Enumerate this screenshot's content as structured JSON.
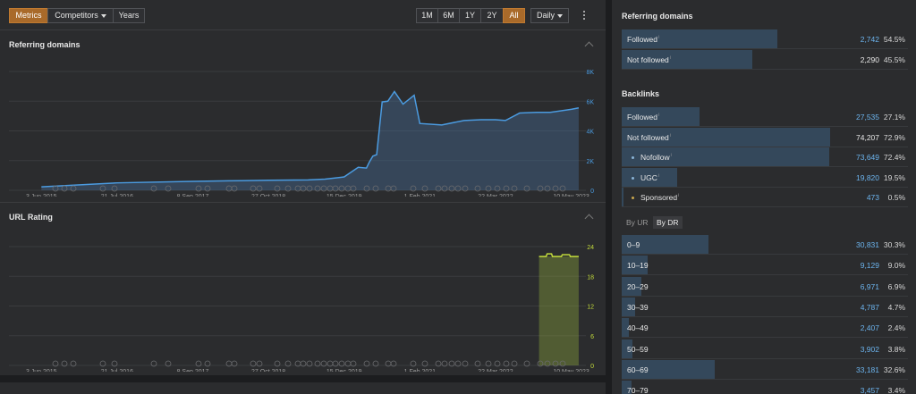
{
  "toolbar": {
    "metrics": "Metrics",
    "competitors": "Competitors",
    "years": "Years",
    "ranges": [
      "1M",
      "6M",
      "1Y",
      "2Y",
      "All"
    ],
    "active_range": "All",
    "granularity": "Daily"
  },
  "panels": {
    "referring_domains_title": "Referring domains",
    "url_rating_title": "URL Rating"
  },
  "x_ticks": [
    "3 Jun 2015",
    "21 Jul 2016",
    "8 Sep 2017",
    "27 Oct 2018",
    "15 Dec 2019",
    "1 Feb 2021",
    "22 Mar 2022",
    "10 May 2023"
  ],
  "colors": {
    "accent": "#a96a2a",
    "line_blue": "#4b9be0",
    "ur_green": "#c4dc3c",
    "bar_blue": "#34485b",
    "link_blue": "#6cb4ee"
  },
  "chart_data": [
    {
      "type": "area",
      "title": "Referring domains",
      "x": [
        "2015-06-03",
        "2016-07-21",
        "2017-09-08",
        "2018-06-01",
        "2018-10-27",
        "2019-06-01",
        "2019-09-01",
        "2019-12-15",
        "2020-03-01",
        "2020-04-15",
        "2020-05-01",
        "2020-05-20",
        "2020-06-10",
        "2020-07-10",
        "2020-08-10",
        "2020-09-15",
        "2020-11-01",
        "2021-01-01",
        "2021-02-01",
        "2021-06-01",
        "2021-10-01",
        "2022-01-01",
        "2022-03-22",
        "2022-05-15",
        "2022-08-01",
        "2022-11-01",
        "2023-01-15",
        "2023-05-10",
        "2023-06-20"
      ],
      "values": [
        230,
        500,
        600,
        650,
        680,
        700,
        750,
        900,
        1550,
        1500,
        1900,
        2300,
        2400,
        5950,
        6000,
        6650,
        5800,
        6400,
        4500,
        4400,
        4700,
        4750,
        4750,
        4700,
        5200,
        5250,
        5250,
        5450,
        5550
      ],
      "ylim": [
        0,
        8000
      ],
      "yticks": [
        "0",
        "2K",
        "4K",
        "6K",
        "8K"
      ],
      "grid": true
    },
    {
      "type": "area",
      "title": "URL Rating",
      "x": [
        "2022-11-15",
        "2023-06-20"
      ],
      "values": [
        22,
        22
      ],
      "ylim": [
        0,
        24
      ],
      "yticks": [
        "0",
        "6",
        "12",
        "18",
        "24"
      ],
      "grid": true
    }
  ],
  "referring_domains": {
    "title": "Referring domains",
    "rows": [
      {
        "label": "Followed",
        "count": "2,742",
        "pct": "54.5%",
        "share": 0.545,
        "link": true
      },
      {
        "label": "Not followed",
        "count": "2,290",
        "pct": "45.5%",
        "share": 0.455,
        "link": false
      }
    ]
  },
  "backlinks": {
    "title": "Backlinks",
    "rows": [
      {
        "label": "Followed",
        "count": "27,535",
        "pct": "27.1%",
        "share": 0.271,
        "link": true,
        "dot": ""
      },
      {
        "label": "Not followed",
        "count": "74,207",
        "pct": "72.9%",
        "share": 0.729,
        "link": false,
        "dot": ""
      },
      {
        "label": "Nofollow",
        "count": "73,649",
        "pct": "72.4%",
        "share": 0.724,
        "link": true,
        "dot": "#8ab4d6"
      },
      {
        "label": "UGC",
        "count": "19,820",
        "pct": "19.5%",
        "share": 0.195,
        "link": true,
        "dot": "#8ab4d6"
      },
      {
        "label": "Sponsored",
        "count": "473",
        "pct": "0.5%",
        "share": 0.005,
        "link": true,
        "dot": "#c9a64d"
      }
    ]
  },
  "dr_tabs": {
    "by_ur": "By UR",
    "by_dr": "By DR",
    "active": "By DR"
  },
  "dr_rows": [
    {
      "label": "0–9",
      "count": "30,831",
      "pct": "30.3%",
      "share": 0.303
    },
    {
      "label": "10–19",
      "count": "9,129",
      "pct": "9.0%",
      "share": 0.09
    },
    {
      "label": "20–29",
      "count": "6,971",
      "pct": "6.9%",
      "share": 0.069
    },
    {
      "label": "30–39",
      "count": "4,787",
      "pct": "4.7%",
      "share": 0.047
    },
    {
      "label": "40–49",
      "count": "2,407",
      "pct": "2.4%",
      "share": 0.024
    },
    {
      "label": "50–59",
      "count": "3,902",
      "pct": "3.8%",
      "share": 0.038
    },
    {
      "label": "60–69",
      "count": "33,181",
      "pct": "32.6%",
      "share": 0.326
    },
    {
      "label": "70–79",
      "count": "3,457",
      "pct": "3.4%",
      "share": 0.034
    }
  ]
}
